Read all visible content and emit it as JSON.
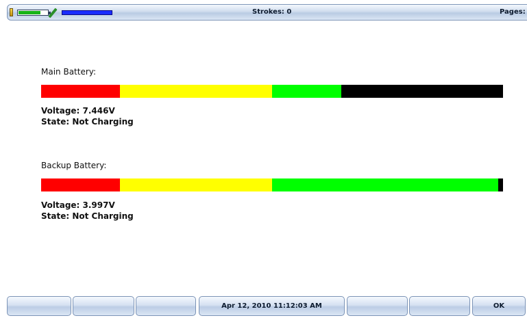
{
  "status_bar": {
    "strokes": "Strokes: 0",
    "pages": "Pages: 0",
    "battery_level_fraction": 0.75,
    "storage_level_fraction": 1.0,
    "icons": [
      "battery-icon",
      "mini-battery-icon",
      "pen-icon",
      "storage-level-icon"
    ],
    "colors": {
      "mini_battery_fill": "#17b317",
      "storage_fill": "#1a2dff"
    }
  },
  "batteries": [
    {
      "label": "Main Battery:",
      "voltage": "Voltage: 7.446V",
      "state": "State: Not Charging",
      "level_fraction": 0.65
    },
    {
      "label": "Backup Battery:",
      "voltage": "Voltage: 3.997V",
      "state": "State: Not Charging",
      "level_fraction": 0.99
    }
  ],
  "bar_colors": {
    "low": "#ff0000",
    "medium": "#ffff00",
    "high": "#00ff00",
    "empty": "#000000"
  },
  "softkeys": {
    "key1": "",
    "key2": "",
    "key3": "",
    "datetime": "Apr 12, 2010  11:12:03 AM",
    "key5": "",
    "key6": "",
    "ok": "OK"
  }
}
